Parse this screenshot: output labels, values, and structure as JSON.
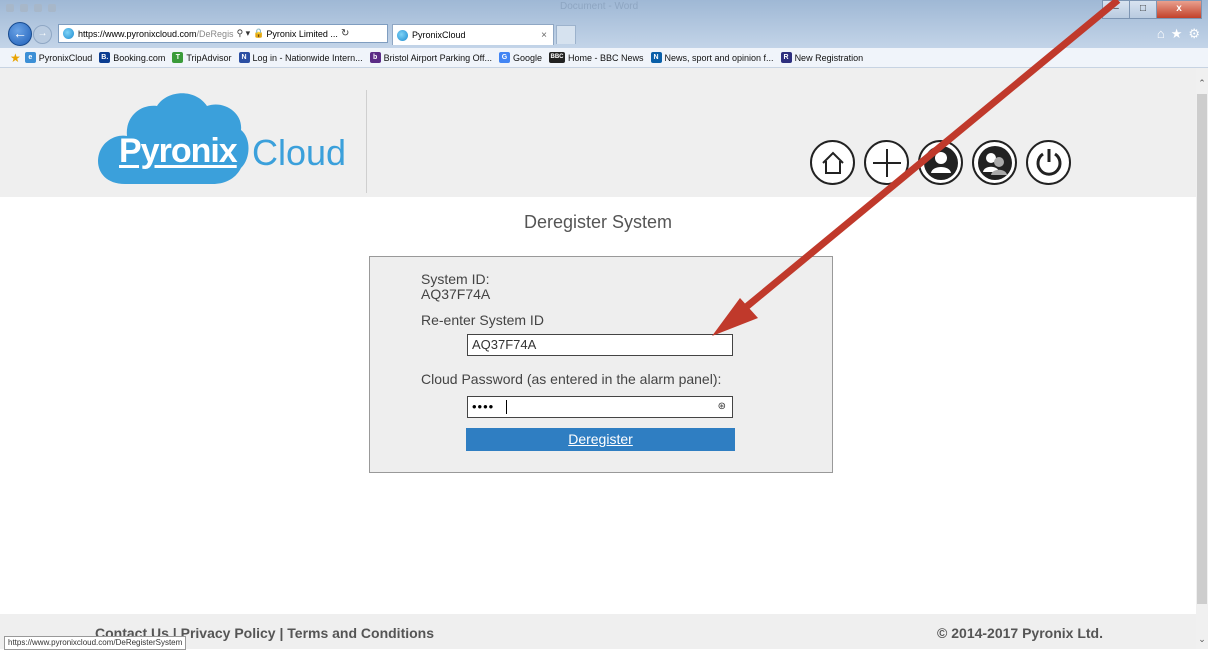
{
  "browser": {
    "window_title": "Document - Word",
    "window_buttons": [
      "–",
      "□",
      "x"
    ],
    "address": {
      "host": "https://www.pyronixcloud.com",
      "path": "/DeRegis"
    },
    "secure_site": "Pyronix Limited ...",
    "tab_title": "PyronixCloud",
    "favorites": [
      {
        "label": "PyronixCloud",
        "color": "#3c8fd6",
        "glyph": "e"
      },
      {
        "label": "Booking.com",
        "color": "#0b3d91",
        "glyph": "B."
      },
      {
        "label": "TripAdvisor",
        "color": "#3a9b3a",
        "glyph": "T"
      },
      {
        "label": "Log in - Nationwide Intern...",
        "color": "#2b4fa3",
        "glyph": "N"
      },
      {
        "label": "Bristol Airport Parking Off...",
        "color": "#5b2c86",
        "glyph": "b"
      },
      {
        "label": "Google",
        "color": "#4285f4",
        "glyph": "G"
      },
      {
        "label": "Home - BBC News",
        "color": "#222222",
        "glyph": "BBC"
      },
      {
        "label": "News, sport and opinion f...",
        "color": "#0a5fa8",
        "glyph": "N"
      },
      {
        "label": "New Registration",
        "color": "#2e2f7e",
        "glyph": "R"
      }
    ],
    "status_url": "https://www.pyronixcloud.com/DeRegisterSystem"
  },
  "header": {
    "logo_brand": "Pyronix",
    "logo_word": "Cloud",
    "nav_icons": [
      "home-icon",
      "add-icon",
      "user-icon",
      "users-icon",
      "power-icon"
    ]
  },
  "page": {
    "heading": "Deregister System",
    "system_id_label": "System ID:",
    "system_id_value": "AQ37F74A",
    "reenter_label": "Re-enter System ID",
    "reenter_value": "AQ37F74A",
    "password_label": "Cloud Password (as entered in the alarm panel):",
    "password_masked": "••••",
    "button_label": "Deregister"
  },
  "footer": {
    "contact": "Contact Us",
    "privacy": "Privacy Policy",
    "terms": "Terms and Conditions",
    "separator": "|",
    "copyright": "© 2014-2017 Pyronix Ltd."
  },
  "colors": {
    "accent": "#3ba0db",
    "button": "#2f7ec2",
    "arrow": "#c0392b"
  }
}
